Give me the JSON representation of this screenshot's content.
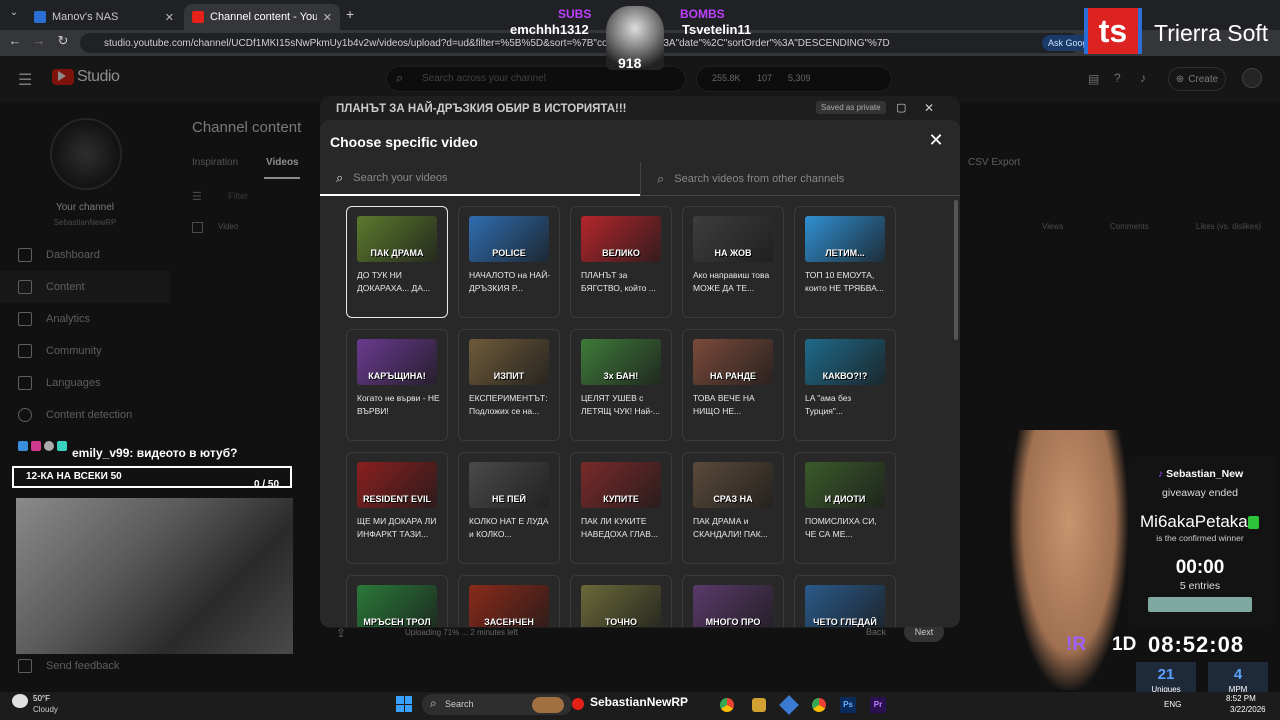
{
  "browser": {
    "tabs": [
      {
        "label": "Manov's NAS",
        "color": "#2b6fd6"
      },
      {
        "label": "Channel content - YouTube Stu",
        "color": "#e62117"
      }
    ],
    "new_tab": "+",
    "url": "studio.youtube.com/channel/UCDf1MKI15sNwPkmUy1b4v2w/videos/upload?d=ud&filter=%5B%5D&sort=%7B\"columnType\"%3A\"date\"%2C\"sortOrder\"%3A\"DESCENDING\"%7D",
    "ask_label": "Ask Goog"
  },
  "stream": {
    "subs_label": "SUBS",
    "subs_name": "emchhh1312",
    "bombs_label": "BOMBS",
    "bombs_name": "Tsvetelin11",
    "center_count": "918",
    "brand_logo": "ts",
    "brand_name": "Trierra Soft",
    "chat_user": "emily_v99",
    "chat_msg": ": видеото в ютуб?",
    "goal_label": "12-КА НА ВСЕКИ 50",
    "goal_count": "0 / 50",
    "giveaway_host": "Sebastian_New",
    "giveaway_status": "giveaway ended",
    "winner": "Mi6akaPetaka",
    "winner_note": "is the confirmed winner",
    "timer": "00:00",
    "entries": "5 entries",
    "clock_prefix": "1D",
    "clock": "08:52:08",
    "uniques_value": "21",
    "uniques_label": "Uniques",
    "mpm_value": "4",
    "mpm_label": "MPM"
  },
  "studio": {
    "logo_text": "Studio",
    "search_placeholder": "Search across your channel",
    "stat1": "255.8K",
    "stat2": "107",
    "stat3": "5,309",
    "create_label": "Create",
    "upload_title": "ПЛАНЪТ ЗА НАЙ-ДРЪЗКИЯ ОБИР В ИСТОРИЯТА!!!",
    "saved_label": "Saved as private",
    "page_title": "Channel content",
    "tab_inspiration": "Inspiration",
    "tab_videos": "Videos",
    "csv_export": "CSV Export",
    "col_video": "Video",
    "col_views": "Views",
    "col_comments": "Comments",
    "col_likes": "Likes (vs. dislikes)",
    "filter_label": "Filter",
    "channel_label": "Your channel",
    "channel_name": "SebastianNewRP",
    "nav": [
      "Dashboard",
      "Content",
      "Analytics",
      "Community",
      "Languages",
      "Content detection"
    ],
    "send_feedback": "Send feedback",
    "uploading_text": "Uploading 71% ... 2 minutes left",
    "back_button": "Back",
    "next_button": "Next"
  },
  "modal": {
    "title": "Choose specific video",
    "search_own": "Search your videos",
    "search_other": "Search videos from other channels",
    "videos": [
      {
        "title": "ДО ТУК НИ ДОКАРАХА... ДА...",
        "thumb_text": "ПАК ДРАМА",
        "color": "#5c7a2e"
      },
      {
        "title": "НАЧАЛОТО на НАЙ-ДРЪЗКИЯ Р...",
        "thumb_text": "POLICE",
        "color": "#2f6db0"
      },
      {
        "title": "ПЛАНЪТ за БЯГСТВО, който ...",
        "thumb_text": "ВЕЛИКО",
        "color": "#b3262c"
      },
      {
        "title": "Ако направиш това МОЖЕ ДА ТЕ...",
        "thumb_text": "НА ЖОВ",
        "color": "#3d3d3d"
      },
      {
        "title": "ТОП 10 ЕМОУТА, които НЕ ТРЯБВА...",
        "thumb_text": "ЛЕТИМ...",
        "color": "#2f8fd1"
      },
      {
        "title": "Когато не върви - НЕ ВЪРВИ!",
        "thumb_text": "КАРЪЩИНА!",
        "color": "#6a3a8f"
      },
      {
        "title": "ЕКСПЕРИМЕНТЪТ: Подложих се на...",
        "thumb_text": "ИЗПИТ",
        "color": "#6e5a3a"
      },
      {
        "title": "ЦЕЛЯТ УШЕВ с ЛЕТЯЩ ЧУК! Най-...",
        "thumb_text": "3x БАН!",
        "color": "#3f7a3a"
      },
      {
        "title": "ТОВА ВЕЧЕ НА НИЩО НЕ...",
        "thumb_text": "НА РАНДЕ",
        "color": "#7a4a3a"
      },
      {
        "title": "LA \"ама без Турция\"...",
        "thumb_text": "КАКВО?!?",
        "color": "#1f6a8a"
      },
      {
        "title": "ЩЕ МИ ДОКАРА ЛИ ИНФАРКТ ТАЗИ...",
        "thumb_text": "RESIDENT EVIL",
        "color": "#8a1f1f"
      },
      {
        "title": "КОЛКО НАТ Е ЛУДА и КОЛКО...",
        "thumb_text": "НЕ ПЕЙ",
        "color": "#4a4a4a"
      },
      {
        "title": "ПАК ЛИ КУКИТЕ НАВЕДОХА ГЛАВ...",
        "thumb_text": "КУПИТЕ",
        "color": "#7a2a2a"
      },
      {
        "title": "ПАК ДРАМА и СКАНДАЛИ! ПАК...",
        "thumb_text": "СРАЗ НА",
        "color": "#5a4a3a"
      },
      {
        "title": "ПОМИСЛИХА СИ, ЧЕ СА МЕ...",
        "thumb_text": "И ДИОТИ",
        "color": "#3a5a2a"
      },
      {
        "title": "",
        "thumb_text": "МРЪСЕН ТРОЛ",
        "color": "#2a7a3a"
      },
      {
        "title": "",
        "thumb_text": "ЗАСЕНЧЕН",
        "color": "#8a2a1a"
      },
      {
        "title": "",
        "thumb_text": "ТОЧНО",
        "color": "#6a6a3a"
      },
      {
        "title": "",
        "thumb_text": "МНОГО ПРО",
        "color": "#5a3a6a"
      },
      {
        "title": "",
        "thumb_text": "ЧЕТО ГЛЕДАЙ",
        "color": "#2a5a8a"
      }
    ]
  },
  "taskbar": {
    "weather_temp": "50°F",
    "weather_desc": "Cloudy",
    "search_label": "Search",
    "pinned_label": "SebastianNewRP",
    "lang": "ENG",
    "time": "8:52 PM",
    "date": "3/22/2026"
  }
}
